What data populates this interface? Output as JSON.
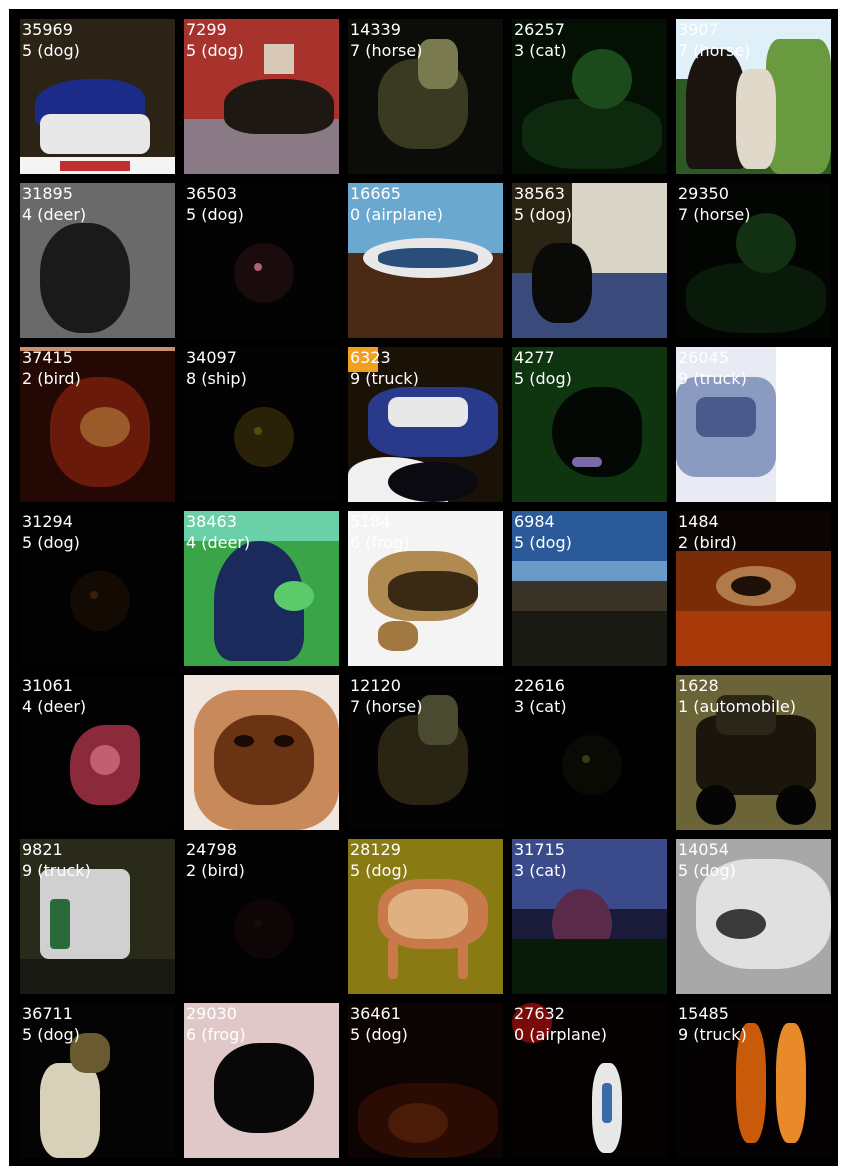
{
  "figure": {
    "rows": 7,
    "cols": 5,
    "tiles": [
      {
        "index": "35969",
        "label": "5 (dog)",
        "bg": "#2b2416",
        "accent": "#1c2a8a",
        "accent2": "#e8e8e8",
        "style": "dog-blue"
      },
      {
        "index": "7299",
        "label": "5 (dog)",
        "bg": "#a8322c",
        "accent": "#1e1812",
        "accent2": "#8a7a86",
        "style": "dog-red"
      },
      {
        "index": "14339",
        "label": "7 (horse)",
        "bg": "#0c0d08",
        "accent": "#3a3a22",
        "accent2": "#7a7a50",
        "style": "dark-mid"
      },
      {
        "index": "26257",
        "label": "3 (cat)",
        "bg": "#041004",
        "accent": "#0e2a0e",
        "accent2": "#1b4a1b",
        "style": "dark-green"
      },
      {
        "index": "3907",
        "label": "7 (horse)",
        "bg": "#2c5a22",
        "accent": "#e0f0f8",
        "accent2": "#6a9a40",
        "style": "horse-bright"
      },
      {
        "index": "31895",
        "label": "4 (deer)",
        "bg": "#4a4a4a",
        "accent": "#1a1a1a",
        "accent2": "#6a6a6a",
        "style": "gray"
      },
      {
        "index": "36503",
        "label": "5 (dog)",
        "bg": "#030303",
        "accent": "#1a0c0c",
        "accent2": "#b06070",
        "style": "dark"
      },
      {
        "index": "16665",
        "label": "0 (airplane)",
        "bg": "#6aa8d0",
        "accent": "#2a4e7a",
        "accent2": "#e8e8e8",
        "style": "plane"
      },
      {
        "index": "38563",
        "label": "5 (dog)",
        "bg": "#2a2414",
        "accent": "#d8d4c8",
        "accent2": "#3a4a7a",
        "style": "dog-house"
      },
      {
        "index": "29350",
        "label": "7 (horse)",
        "bg": "#020502",
        "accent": "#0a1a0a",
        "accent2": "#123012",
        "style": "dark-green"
      },
      {
        "index": "37415",
        "label": "2 (bird)",
        "bg": "#240804",
        "accent": "#6a1a0a",
        "accent2": "#9a5a2a",
        "style": "bird-red"
      },
      {
        "index": "34097",
        "label": "8 (ship)",
        "bg": "#030303",
        "accent": "#2a2208",
        "accent2": "#5a4a10",
        "style": "dark"
      },
      {
        "index": "6323",
        "label": "9 (truck)",
        "bg": "#1a1206",
        "accent": "#2a3a8a",
        "accent2": "#e8e8e8",
        "style": "truck"
      },
      {
        "index": "4277",
        "label": "5 (dog)",
        "bg": "#0e3410",
        "accent": "#040804",
        "accent2": "#1e5a1a",
        "style": "dog-grass"
      },
      {
        "index": "26045",
        "label": "9 (truck)",
        "bg": "#e8eaf4",
        "accent": "#4a5a8a",
        "accent2": "#ffffff",
        "style": "truck-bright"
      },
      {
        "index": "31294",
        "label": "5 (dog)",
        "bg": "#020202",
        "accent": "#140a04",
        "accent2": "#3a2008",
        "style": "dark"
      },
      {
        "index": "38463",
        "label": "4 (deer)",
        "bg": "#3aa448",
        "accent": "#1a2a5a",
        "accent2": "#5aca6a",
        "style": "deer-green"
      },
      {
        "index": "5184",
        "label": "6 (frog)",
        "bg": "#f4f4f4",
        "accent": "#3a2a14",
        "accent2": "#b08a50",
        "style": "frog-white"
      },
      {
        "index": "6984",
        "label": "5 (dog)",
        "bg": "#3a6aa8",
        "accent": "#1a1a14",
        "accent2": "#6a9ac8",
        "style": "dog-sea"
      },
      {
        "index": "1484",
        "label": "2 (bird)",
        "bg": "#7a2c08",
        "accent": "#1e1008",
        "accent2": "#b07a4a",
        "style": "bird-orange"
      },
      {
        "index": "31061",
        "label": "4 (deer)",
        "bg": "#030202",
        "accent": "#8a2a3a",
        "accent2": "#c06070",
        "style": "deer-dark"
      },
      {
        "index": "",
        "label": "",
        "bg": "#f0e8e0",
        "accent": "#6a3414",
        "accent2": "#c88a5a",
        "style": "cat-face"
      },
      {
        "index": "12120",
        "label": "7 (horse)",
        "bg": "#030303",
        "accent": "#2a2414",
        "accent2": "#4a4a30",
        "style": "dark-mid"
      },
      {
        "index": "22616",
        "label": "3 (cat)",
        "bg": "#010101",
        "accent": "#0a0a04",
        "accent2": "#3a3a14",
        "style": "dark"
      },
      {
        "index": "1628",
        "label": "1 (automobile)",
        "bg": "#6a6438",
        "accent": "#1a160c",
        "accent2": "#8a8450",
        "style": "car"
      },
      {
        "index": "9821",
        "label": "9 (truck)",
        "bg": "#2a2a1a",
        "accent": "#d0d0d0",
        "accent2": "#2a6a3a",
        "style": "truck-white"
      },
      {
        "index": "24798",
        "label": "2 (bird)",
        "bg": "#020202",
        "accent": "#0e0606",
        "accent2": "#1a0c0c",
        "style": "dark"
      },
      {
        "index": "28129",
        "label": "5 (dog)",
        "bg": "#8a7a14",
        "accent": "#c87a4a",
        "accent2": "#e0b080",
        "style": "dog-yellow"
      },
      {
        "index": "31715",
        "label": "3 (cat)",
        "bg": "#1a1a3a",
        "accent": "#5a2a4a",
        "accent2": "#3a4a8a",
        "style": "cat-purple"
      },
      {
        "index": "14054",
        "label": "5 (dog)",
        "bg": "#a8a8a8",
        "accent": "#e0e0e0",
        "accent2": "#3a3a3a",
        "style": "dog-gray"
      },
      {
        "index": "36711",
        "label": "5 (dog)",
        "bg": "#040404",
        "accent": "#d8d0b8",
        "accent2": "#6a5a30",
        "style": "dog-white-dark"
      },
      {
        "index": "29030",
        "label": "6 (frog)",
        "bg": "#c8a8a8",
        "accent": "#080808",
        "accent2": "#e0c8c8",
        "style": "frog-pink"
      },
      {
        "index": "36461",
        "label": "5 (dog)",
        "bg": "#0c0402",
        "accent": "#2a0c04",
        "accent2": "#4a1c08",
        "style": "dark-red"
      },
      {
        "index": "27632",
        "label": "0 (airplane)",
        "bg": "#060202",
        "accent": "#7a0a0a",
        "accent2": "#e8e8e8",
        "style": "plane-dark"
      },
      {
        "index": "15485",
        "label": "9 (truck)",
        "bg": "#040202",
        "accent": "#c85a0a",
        "accent2": "#e88a2a",
        "style": "truck-orange"
      }
    ]
  }
}
